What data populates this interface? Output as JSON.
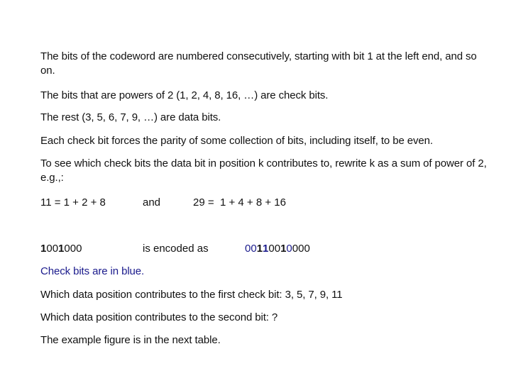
{
  "colors": {
    "check_bit": "#1a1a8c",
    "text": "#111111"
  },
  "paragraphs": {
    "p1": "The bits of the codeword are numbered consecutively, starting with bit 1 at the left end, and so on.",
    "p2": "The bits that are powers of 2 (1, 2, 4, 8, 16, …) are check bits.",
    "p3": "The rest (3, 5, 6, 7, 9, …) are data bits.",
    "p4": "Each check bit forces the parity of some collection of bits, including itself, to be even.",
    "p5": "To see which check bits the data bit in position k contributes to, rewrite k as a sum of power of 2, e.g.,:"
  },
  "example_sums": {
    "left": "11 = 1 + 2 + 8",
    "connector": "and",
    "right": "29 =  1 + 4 + 8 + 16"
  },
  "encoding": {
    "data_bits": [
      {
        "d": "1",
        "bold": true
      },
      {
        "d": "0",
        "bold": false
      },
      {
        "d": "0",
        "bold": false
      },
      {
        "d": "1",
        "bold": true
      },
      {
        "d": "0",
        "bold": false
      },
      {
        "d": "0",
        "bold": false
      },
      {
        "d": "0",
        "bold": false
      }
    ],
    "label": "is encoded as",
    "encoded_bits": [
      {
        "d": "0",
        "check": true,
        "bold": false
      },
      {
        "d": "0",
        "check": true,
        "bold": false
      },
      {
        "d": "1",
        "check": false,
        "bold": true
      },
      {
        "d": "1",
        "check": true,
        "bold": true
      },
      {
        "d": "0",
        "check": false,
        "bold": false
      },
      {
        "d": "0",
        "check": false,
        "bold": false
      },
      {
        "d": "1",
        "check": false,
        "bold": true
      },
      {
        "d": "0",
        "check": true,
        "bold": false
      },
      {
        "d": "0",
        "check": false,
        "bold": false
      },
      {
        "d": "0",
        "check": false,
        "bold": false
      },
      {
        "d": "0",
        "check": false,
        "bold": false
      }
    ]
  },
  "notes": {
    "check_bits_note": "Check bits are in blue.",
    "q1_prefix": "Which data position contributes to the first check bit: ",
    "q1_answer": "3, 5, 7, 9, 11",
    "q2": "Which data position contributes to the second bit: ?",
    "closing": "The example figure is in the next table."
  }
}
